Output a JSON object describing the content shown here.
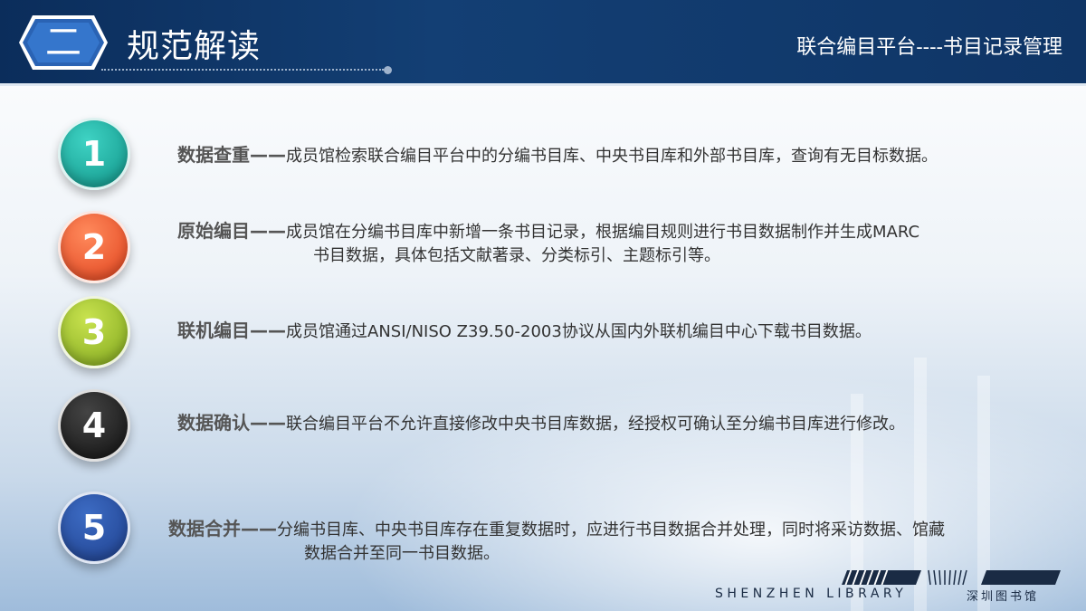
{
  "header": {
    "section_number": "二",
    "section_title": "规范解读",
    "platform_title": "联合编目平台----书目记录管理"
  },
  "items": [
    {
      "number": "1",
      "heading": "数据查重——",
      "content": "成员馆检索联合编目平台中的分编书目库、中央书目库和外部书目库，查询有无目标数据。",
      "content_cont": "",
      "color": "#1aa89a"
    },
    {
      "number": "2",
      "heading": "原始编目——",
      "content": "成员馆在分编书目库中新增一条书目记录，根据编目规则进行书目数据制作并生成MARC",
      "content_cont": "书目数据，具体包括文献著录、分类标引、主题标引等。",
      "color": "#f05a2a"
    },
    {
      "number": "3",
      "heading": "联机编目——",
      "content": "成员馆通过ANSI/NISO Z39.50-2003协议从国内外联机编目中心下载书目数据。",
      "content_cont": "",
      "color": "#9bc22e"
    },
    {
      "number": "4",
      "heading": "数据确认——",
      "content": "联合编目平台不允许直接修改中央书目库数据，经授权可确认至分编书目库进行修改。",
      "content_cont": "",
      "color": "#1a1a1a"
    },
    {
      "number": "5",
      "heading": "数据合并——",
      "content": "分编书目库、中央书目库存在重复数据时，应进行书目数据合并处理，同时将采访数据、馆藏",
      "content_cont": "数据合并至同一书目数据。",
      "color": "#26489a"
    }
  ],
  "logo": {
    "english": "SHENZHEN LIBRARY",
    "chinese": "深圳图书馆"
  }
}
